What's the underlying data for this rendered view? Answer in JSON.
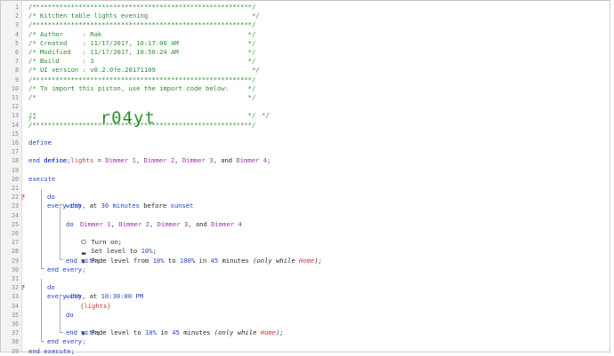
{
  "header": {
    "rule": "/*********************************************************/",
    "title": "/* Kitchen table lights evening                           */",
    "author": "/* Author     : Rak                                      */",
    "created": "/* Created    : 11/17/2017, 10:17:06 AM                  */",
    "modified": "/* Modified   : 11/17/2017, 10:50:24 AM                  */",
    "build": "/* Build      : 3                                        */",
    "ui": "/* UI version : v0.2.0fe.20171109                         */",
    "import_line": "/* To import this piston, use the import code below:     */",
    "blank": "/*                                                       */",
    "code_prefix": "/*",
    "code_suffix": "*/",
    "import_code": "r04yt"
  },
  "code": {
    "define": "define",
    "device_kw": "device",
    "var_name": "lights",
    "eq": " = ",
    "d1": "Dimmer 1",
    "d2": "Dimmer 2",
    "d3": "Dimmer 3",
    "d4": "Dimmer 4",
    "comma": ", ",
    "and": ", and ",
    "semi": ";",
    "end_define": "end define;",
    "execute": "execute",
    "every": "every",
    "day": "day",
    "at": ", at ",
    "n30": "30",
    "minutes": "minutes",
    "before": "before",
    "sunset": "sunset",
    "do": "do",
    "with": "with",
    "turn_on": "Turn on;",
    "set_level": "Set level to ",
    "p10": "10%",
    "fade_from": "Fade level from ",
    "to": " to ",
    "p100": "100%",
    "in": " in ",
    "n45": "45",
    "minutes_plain": " minutes ",
    "only_while": "(only while ",
    "home": "Home",
    "close_paren_semi": ");",
    "end_with": "end with;",
    "end_every": "end every;",
    "time2": "10:30:00 PM",
    "lights_ref": "{lights}",
    "fade_to": "Fade level to ",
    "end_execute": "end execute;"
  },
  "gutter": {
    "numbers": [
      "1",
      "2",
      "3",
      "4",
      "5",
      "6",
      "7",
      "8",
      "9",
      "10",
      "11",
      "12",
      "13",
      "14",
      "15",
      "16",
      "17",
      "18",
      "19",
      "20",
      "21",
      "22",
      "23",
      "24",
      "25",
      "26",
      "27",
      "28",
      "29",
      "30",
      "31",
      "32",
      "33",
      "34",
      "35",
      "36",
      "37",
      "38",
      "39"
    ],
    "marker": "⁋"
  },
  "colors": {
    "comment": "#2a8a2a",
    "keyword": "#1a3fbf",
    "device": "#9b2aa6",
    "location": "#c2353d"
  },
  "icons": [
    "power-icon",
    "signal-bars-icon",
    "half-circle-icon"
  ]
}
